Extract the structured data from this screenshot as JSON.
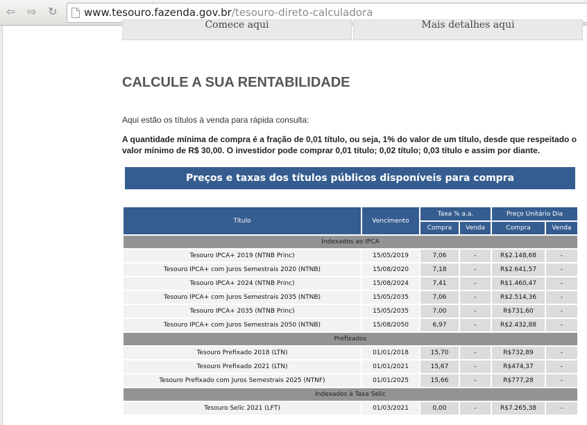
{
  "browser": {
    "url_host": "www.tesouro.fazenda.gov.br",
    "url_path": "/tesouro-direto-calculadora"
  },
  "top_buttons": {
    "start": "Comece aqui",
    "details": "Mais detalhes aqui"
  },
  "page": {
    "title": "CALCULE A SUA RENTABILIDADE",
    "intro": "Aqui estão os títulos à venda para rápida consulta:",
    "note": "A quantidade mínima de compra é a fração de 0,01 título, ou seja, 1% do valor de um título, desde que respeitado o valor mínimo de R$ 30,00. O investidor pode comprar 0,01 título; 0,02 título; 0,03 título e assim por diante.",
    "banner": "Preços e taxas dos títulos públicos disponíveis para compra"
  },
  "table": {
    "headers": {
      "titulo": "Título",
      "vencimento": "Vencimento",
      "taxa": "Taxa % a.a.",
      "preco": "Preço Unitário Dia",
      "compra": "Compra",
      "venda": "Venda"
    },
    "groups": [
      {
        "name": "Indexados ao IPCA",
        "rows": [
          {
            "titulo": "Tesouro IPCA+ 2019 (NTNB Princ)",
            "vencimento": "15/05/2019",
            "taxa_compra": "7,06",
            "taxa_venda": "-",
            "preco_compra": "R$2.148,68",
            "preco_venda": "-"
          },
          {
            "titulo": "Tesouro IPCA+ com Juros Semestrais 2020 (NTNB)",
            "vencimento": "15/08/2020",
            "taxa_compra": "7,18",
            "taxa_venda": "-",
            "preco_compra": "R$2.641,57",
            "preco_venda": "-"
          },
          {
            "titulo": "Tesouro IPCA+ 2024 (NTNB Princ)",
            "vencimento": "15/08/2024",
            "taxa_compra": "7,41",
            "taxa_venda": "-",
            "preco_compra": "R$1.460,47",
            "preco_venda": "-"
          },
          {
            "titulo": "Tesouro IPCA+ com Juros Semestrais 2035 (NTNB)",
            "vencimento": "15/05/2035",
            "taxa_compra": "7,06",
            "taxa_venda": "-",
            "preco_compra": "R$2.514,36",
            "preco_venda": "-"
          },
          {
            "titulo": "Tesouro IPCA+ 2035 (NTNB Princ)",
            "vencimento": "15/05/2035",
            "taxa_compra": "7,00",
            "taxa_venda": "-",
            "preco_compra": "R$731,60",
            "preco_venda": "-"
          },
          {
            "titulo": "Tesouro IPCA+ com Juros Semestrais 2050 (NTNB)",
            "vencimento": "15/08/2050",
            "taxa_compra": "6,97",
            "taxa_venda": "-",
            "preco_compra": "R$2.432,88",
            "preco_venda": "-"
          }
        ]
      },
      {
        "name": "Prefixados",
        "rows": [
          {
            "titulo": "Tesouro Prefixado 2018 (LTN)",
            "vencimento": "01/01/2018",
            "taxa_compra": "15,70",
            "taxa_venda": "-",
            "preco_compra": "R$732,89",
            "preco_venda": "-"
          },
          {
            "titulo": "Tesouro Prefixado 2021 (LTN)",
            "vencimento": "01/01/2021",
            "taxa_compra": "15,67",
            "taxa_venda": "-",
            "preco_compra": "R$474,37",
            "preco_venda": "-"
          },
          {
            "titulo": "Tesouro Prefixado com Juros Semestrais 2025 (NTNF)",
            "vencimento": "01/01/2025",
            "taxa_compra": "15,66",
            "taxa_venda": "-",
            "preco_compra": "R$777,28",
            "preco_venda": "-"
          }
        ]
      },
      {
        "name": "Indexados à Taxa Selic",
        "rows": [
          {
            "titulo": "Tesouro Selic 2021 (LFT)",
            "vencimento": "01/03/2021",
            "taxa_compra": "0,00",
            "taxa_venda": "-",
            "preco_compra": "R$7.265,38",
            "preco_venda": "-"
          }
        ]
      }
    ]
  }
}
